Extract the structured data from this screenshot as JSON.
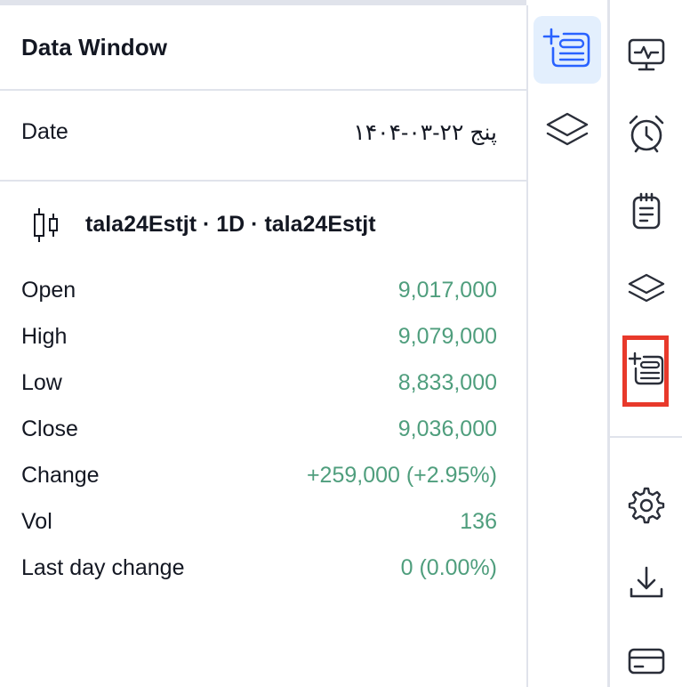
{
  "panel": {
    "title": "Data Window"
  },
  "date_row": {
    "label": "Date",
    "value": "پنج ۲۲-۰۳-۱۴۰۴"
  },
  "symbol": {
    "text": "tala24Estjt · 1D · tala24Estjt",
    "icon": "candlestick-icon"
  },
  "rows": [
    {
      "label": "Open",
      "value": "9,017,000"
    },
    {
      "label": "High",
      "value": "9,079,000"
    },
    {
      "label": "Low",
      "value": "8,833,000"
    },
    {
      "label": "Close",
      "value": "9,036,000"
    },
    {
      "label": "Change",
      "value": "+259,000 (+2.95%)"
    },
    {
      "label": "Vol",
      "value": "136"
    },
    {
      "label": "Last day change",
      "value": "0 (0.00%)"
    }
  ],
  "mid_toolbar": {
    "items": [
      {
        "icon": "data-window-icon",
        "active": true
      },
      {
        "icon": "layers-icon",
        "active": false
      }
    ]
  },
  "right_toolbar": {
    "items": [
      {
        "icon": "monitor-pulse-icon"
      },
      {
        "icon": "alarm-clock-icon"
      },
      {
        "icon": "notepad-icon"
      },
      {
        "icon": "layers-icon"
      },
      {
        "icon": "data-window-icon",
        "highlighted": true
      },
      {
        "icon": "gear-icon"
      },
      {
        "icon": "download-icon"
      },
      {
        "icon": "card-icon"
      }
    ]
  },
  "colors": {
    "positive": "#4f9e7d",
    "text": "#131722",
    "divider": "#e0e3eb",
    "active_bg": "#e3effd",
    "active_icon": "#2962ff",
    "highlight": "#e8392b",
    "icon": "#2a2e39"
  }
}
